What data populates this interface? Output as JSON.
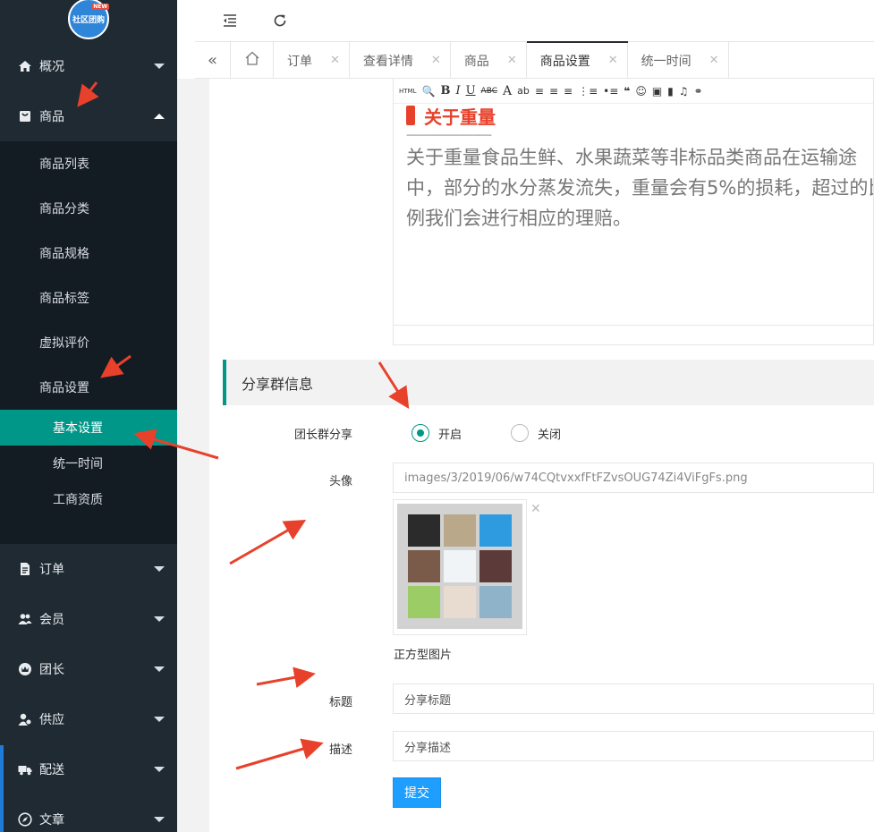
{
  "logo": {
    "text": "社区团购",
    "badge": "NEW"
  },
  "sidebar": {
    "items": [
      {
        "label": "概况",
        "icon": "home-icon"
      },
      {
        "label": "商品",
        "icon": "shopping-bag-icon"
      },
      {
        "label": "订单",
        "icon": "file-icon"
      },
      {
        "label": "会员",
        "icon": "users-icon"
      },
      {
        "label": "团长",
        "icon": "crown-icon"
      },
      {
        "label": "供应",
        "icon": "supplier-icon"
      },
      {
        "label": "配送",
        "icon": "truck-icon"
      },
      {
        "label": "文章",
        "icon": "compass-icon"
      }
    ],
    "goods_sub": [
      {
        "label": "商品列表"
      },
      {
        "label": "商品分类"
      },
      {
        "label": "商品规格"
      },
      {
        "label": "商品标签"
      },
      {
        "label": "虚拟评价"
      },
      {
        "label": "商品设置"
      }
    ],
    "settings_sub": [
      {
        "label": "基本设置"
      },
      {
        "label": "统一时间"
      },
      {
        "label": "工商资质"
      }
    ]
  },
  "tabs": [
    {
      "label": "订单"
    },
    {
      "label": "查看详情"
    },
    {
      "label": "商品"
    },
    {
      "label": "商品设置"
    },
    {
      "label": "统一时间"
    }
  ],
  "editor": {
    "heading": "关于重量",
    "dash": "--------------------------------",
    "text": "关于重量食品生鲜、水果蔬菜等非标品类商品在运输途中，部分的水分蒸发流失，重量会有5%的损耗，超过的比例我们会进行相应的理赔。",
    "toolbar": [
      "HTML",
      "B",
      "I",
      "U",
      "ABC",
      "A",
      "ab"
    ]
  },
  "section": {
    "title": "分享群信息"
  },
  "form": {
    "share_label": "团长群分享",
    "radio_on": "开启",
    "radio_off": "关闭",
    "avatar_label": "头像",
    "avatar_value": "images/3/2019/06/w74CQtvxxfFtFZvsOUG74Zi4ViFgFs.png",
    "avatar_hint": "正方型图片",
    "title_label": "标题",
    "title_value": "分享标题",
    "desc_label": "描述",
    "desc_value": "分享描述",
    "submit": "提交"
  },
  "colors": {
    "sidebar": "#1f2a33",
    "active": "#009688",
    "primary": "#1e9fff",
    "annotation": "#e8412b"
  }
}
